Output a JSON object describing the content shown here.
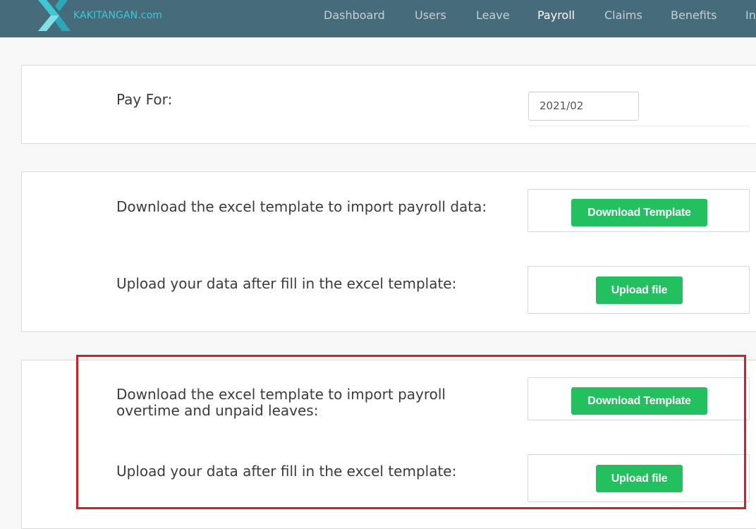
{
  "brand": {
    "name": "KAKITANGAN.com"
  },
  "nav": {
    "items": [
      "Dashboard",
      "Users",
      "Leave",
      "Payroll",
      "Claims",
      "Benefits",
      "In"
    ],
    "active": "Payroll"
  },
  "pay_for": {
    "label": "Pay For:",
    "value": "2021/02"
  },
  "payroll_import": {
    "download_label": "Download the excel template to import payroll data:",
    "download_button": "Download Template",
    "upload_label": "Upload your data after fill in the excel template:",
    "upload_button": "Upload file"
  },
  "overtime_import": {
    "download_label_line1": "Download the excel template to import payroll",
    "download_label_line2": "overtime and unpaid leaves:",
    "download_button": "Download Template",
    "upload_label": "Upload your data after fill in the excel template:",
    "upload_button": "Upload file"
  },
  "colors": {
    "topbar": "#466b7a",
    "brand": "#3fc8d4",
    "button": "#22c05e",
    "highlight": "#dc1c23"
  }
}
